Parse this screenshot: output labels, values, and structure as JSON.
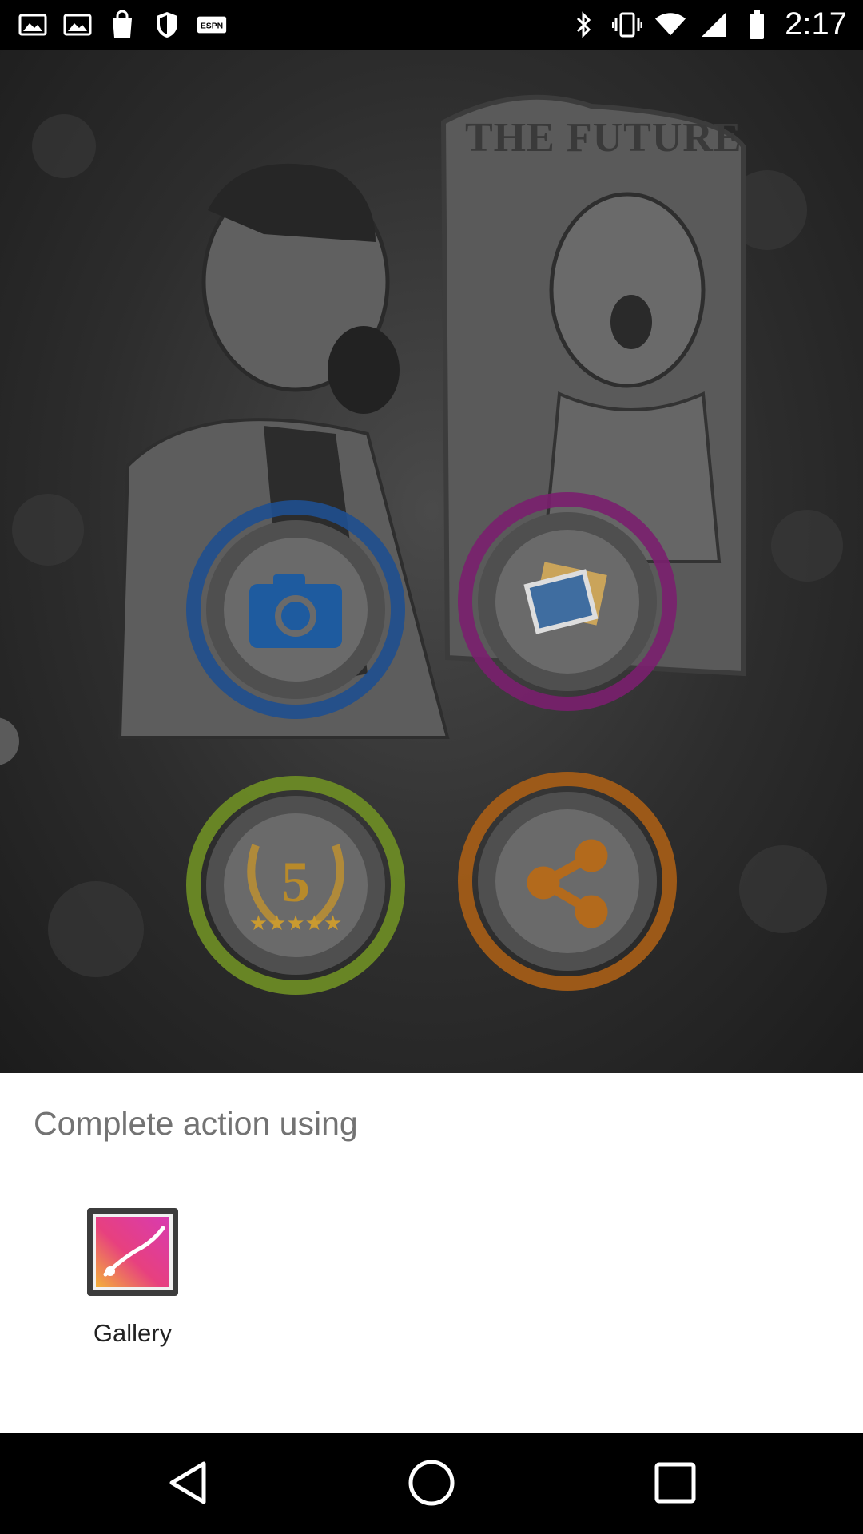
{
  "status_bar": {
    "time": "2:17",
    "left_icons": [
      "gallery-notification-icon",
      "photo-notification-icon",
      "shopping-bag-icon",
      "shield-icon",
      "espn-icon"
    ],
    "right_icons": [
      "bluetooth-icon",
      "vibrate-icon",
      "wifi-icon",
      "signal-icon",
      "battery-icon"
    ]
  },
  "app": {
    "mirror_text": "THE FUTURE",
    "buttons": [
      {
        "name": "camera-button",
        "icon": "camera-icon",
        "ring_color": "#1f63b5"
      },
      {
        "name": "gallery-button",
        "icon": "photos-icon",
        "ring_color": "#9a1f86"
      },
      {
        "name": "rate-button",
        "icon": "laurel-5-stars-icon",
        "ring_color": "#8dbb2a"
      },
      {
        "name": "share-button",
        "icon": "share-icon",
        "ring_color": "#d87a1a"
      }
    ]
  },
  "chooser": {
    "title": "Complete action using",
    "options": [
      {
        "label": "Gallery",
        "icon": "gallery-app-icon"
      }
    ]
  },
  "nav_bar": {
    "buttons": [
      "back-icon",
      "home-icon",
      "recents-icon"
    ]
  }
}
